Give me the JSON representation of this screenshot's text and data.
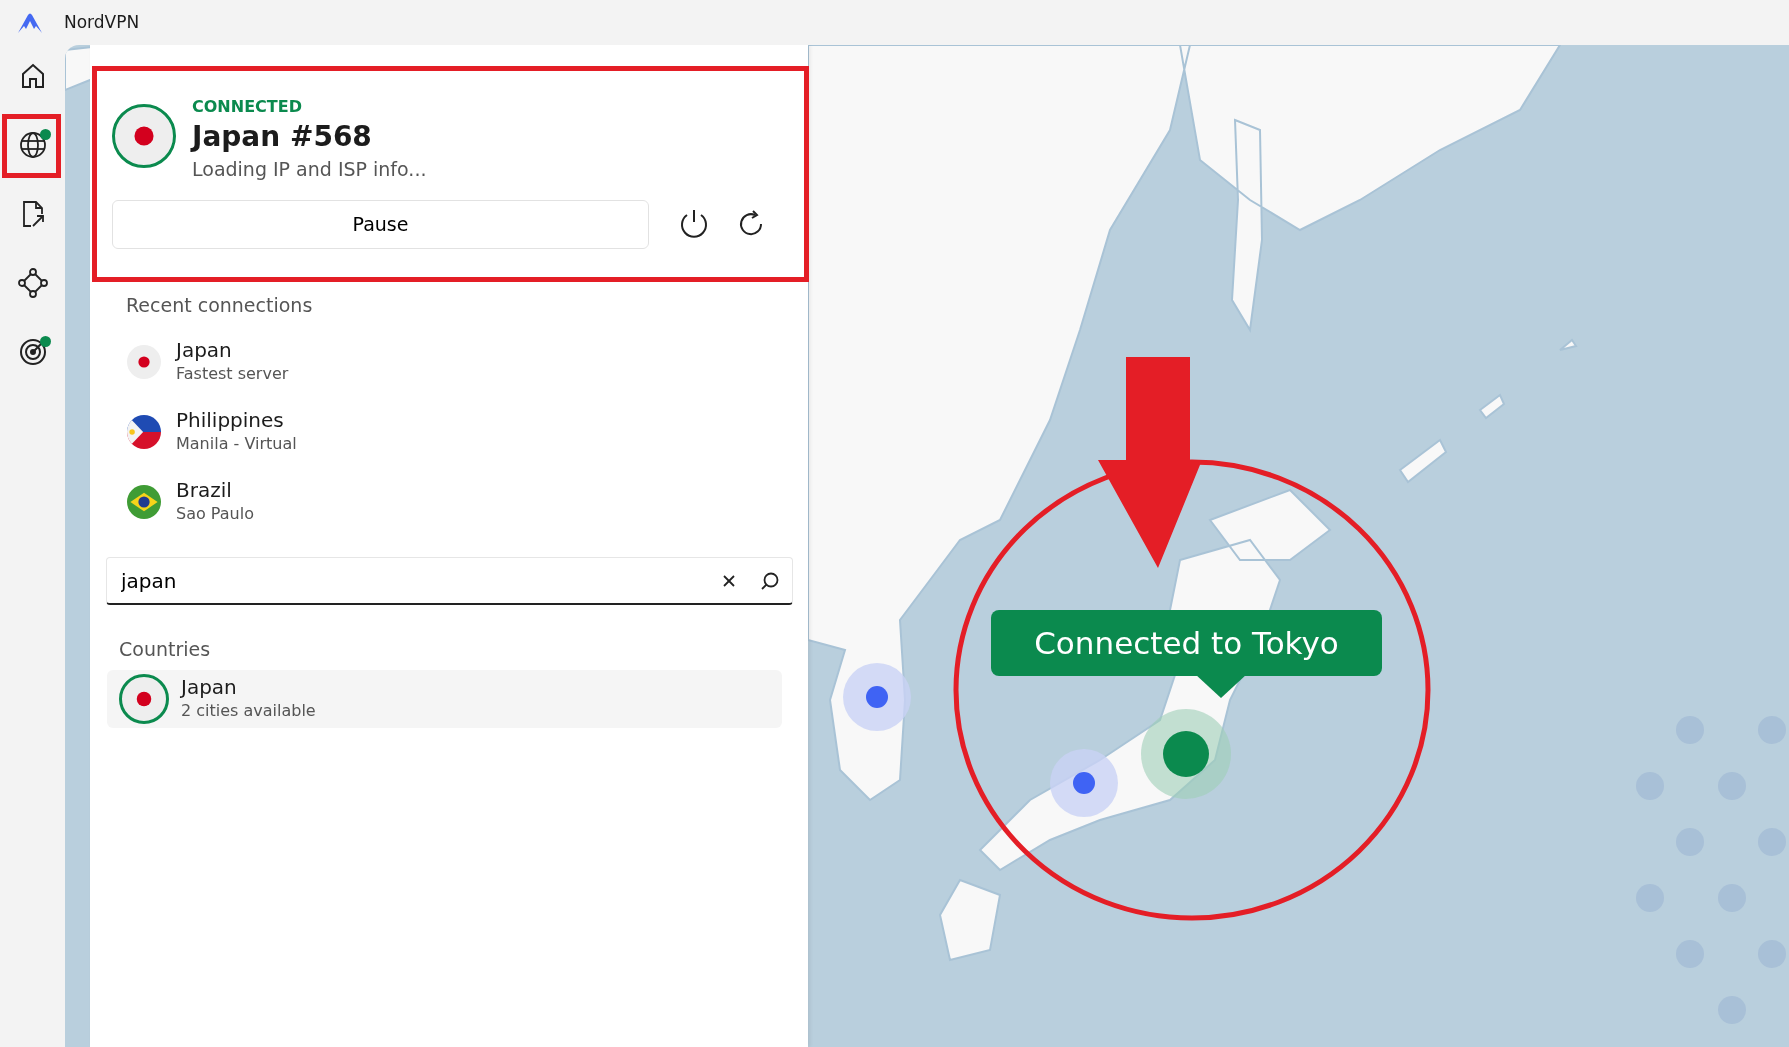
{
  "window": {
    "title": "NordVPN"
  },
  "sidebar": {
    "items": [
      {
        "kind": "home",
        "badge": false
      },
      {
        "kind": "globe",
        "badge": true
      },
      {
        "kind": "file",
        "badge": false
      },
      {
        "kind": "mesh",
        "badge": false
      },
      {
        "kind": "target",
        "badge": true
      }
    ]
  },
  "connection": {
    "status": "CONNECTED",
    "server": "Japan #568",
    "info": "Loading IP and ISP info...",
    "kind": "japan",
    "pause_button": "Pause"
  },
  "recent": {
    "heading": "Recent connections",
    "items": [
      {
        "name": "Japan",
        "detail": "Fastest server",
        "kind": "japan"
      },
      {
        "name": "Philippines",
        "detail": "Manila - Virtual",
        "kind": "philippines"
      },
      {
        "name": "Brazil",
        "detail": "Sao Paulo",
        "kind": "brazil"
      }
    ]
  },
  "search": {
    "value": "japan"
  },
  "results": {
    "heading": "Countries",
    "items": [
      {
        "name": "Japan",
        "detail": "2 cities available",
        "kind": "japan",
        "connected": true
      }
    ]
  },
  "map": {
    "tooltip": "Connected to Tokyo"
  }
}
